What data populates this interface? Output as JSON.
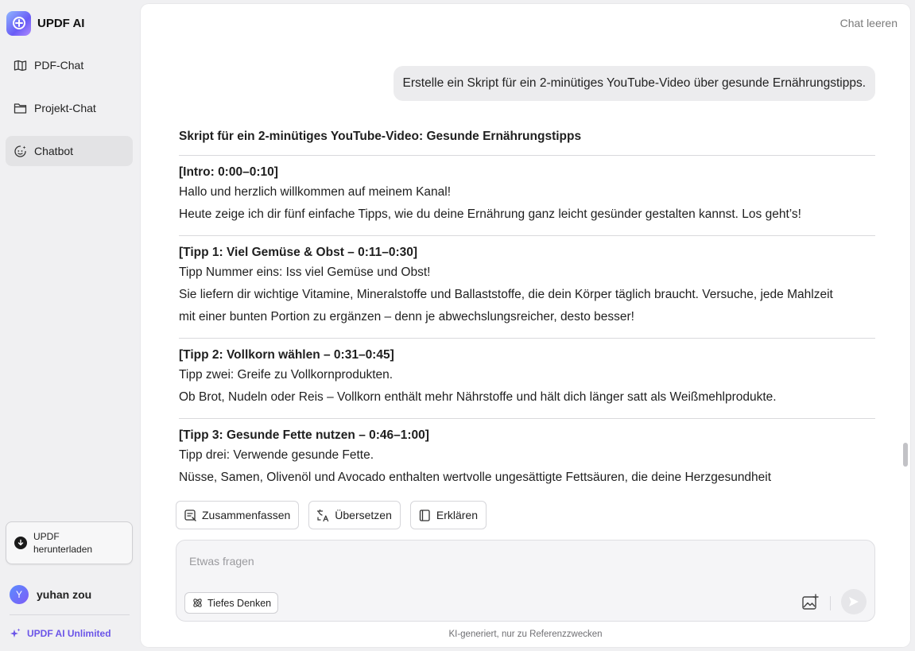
{
  "sidebar": {
    "brand": "UPDF AI",
    "items": [
      {
        "label": "PDF-Chat",
        "icon": "book-open-icon"
      },
      {
        "label": "Projekt-Chat",
        "icon": "folder-icon"
      },
      {
        "label": "Chatbot",
        "icon": "chatbot-icon",
        "active": true
      }
    ],
    "download": {
      "line1": "UPDF",
      "line2": "herunterladen"
    },
    "user": {
      "initial": "Y",
      "name": "yuhan zou"
    },
    "unlimited_label": "UPDF AI Unlimited"
  },
  "header": {
    "clear_label": "Chat leeren"
  },
  "chat": {
    "user_message": "Erstelle ein Skript für ein 2-minütiges YouTube-Video über gesunde Ernährungstipps.",
    "answer": {
      "title": "Skript für ein 2-minütiges YouTube-Video: Gesunde Ernährungstipps",
      "sections": [
        {
          "heading": "[Intro: 0:00–0:10]",
          "lines": [
            "Hallo und herzlich willkommen auf meinem Kanal!",
            "Heute zeige ich dir fünf einfache Tipps, wie du deine Ernährung ganz leicht gesünder gestalten kannst. Los geht’s!"
          ]
        },
        {
          "heading": "[Tipp 1: Viel Gemüse & Obst – 0:11–0:30]",
          "lines": [
            "Tipp Nummer eins: Iss viel Gemüse und Obst!",
            "Sie liefern dir wichtige Vitamine, Mineralstoffe und Ballaststoffe, die dein Körper täglich braucht. Versuche, jede Mahlzeit",
            "mit einer bunten Portion zu ergänzen – denn je abwechslungsreicher, desto besser!"
          ]
        },
        {
          "heading": "[Tipp 2: Vollkorn wählen – 0:31–0:45]",
          "lines": [
            "Tipp zwei: Greife zu Vollkornprodukten.",
            "Ob Brot, Nudeln oder Reis – Vollkorn enthält mehr Nährstoffe und hält dich länger satt als Weißmehlprodukte."
          ]
        },
        {
          "heading": "[Tipp 3: Gesunde Fette nutzen – 0:46–1:00]",
          "lines": [
            "Tipp drei: Verwende gesunde Fette.",
            "Nüsse, Samen, Olivenöl und Avocado enthalten wertvolle ungesättigte Fettsäuren, die deine Herzgesundheit"
          ]
        }
      ]
    }
  },
  "actions": {
    "summarize": "Zusammenfassen",
    "translate": "Übersetzen",
    "explain": "Erklären"
  },
  "input": {
    "placeholder": "Etwas fragen",
    "deep_think": "Tiefes Denken"
  },
  "footer": {
    "disclaimer": "KI-generiert, nur zu Referenzzwecken"
  },
  "colors": {
    "accent": "#6b55e8",
    "active_nav": "#e3e3e5",
    "bubble": "#ececee"
  }
}
